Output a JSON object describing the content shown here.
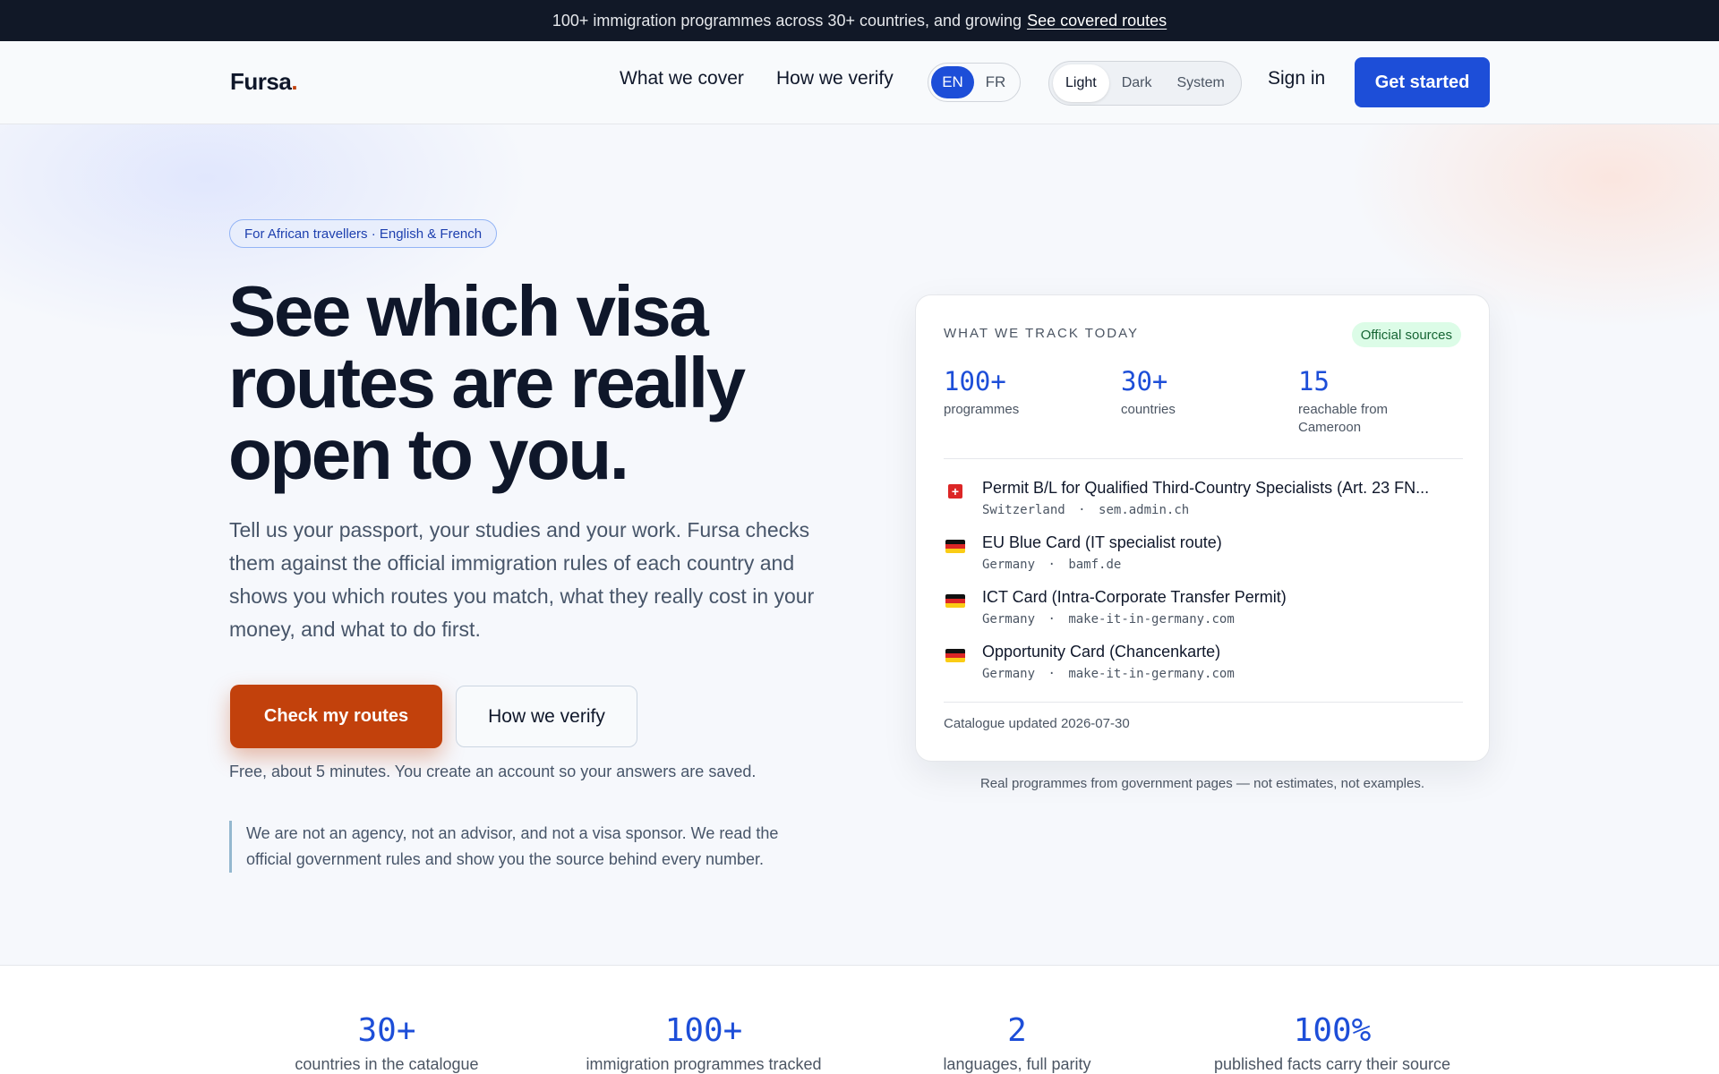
{
  "announcement": {
    "text": "100+ immigration programmes across 30+ countries, and growing",
    "link": "See covered routes"
  },
  "header": {
    "logo": "Fursa",
    "logo_dot": ".",
    "nav": [
      "What we cover",
      "How we verify"
    ],
    "languages": [
      "EN",
      "FR"
    ],
    "active_language": "EN",
    "themes": [
      "Light",
      "Dark",
      "System"
    ],
    "active_theme": "Light",
    "sign_in": "Sign in",
    "get_started": "Get started"
  },
  "hero": {
    "pill": "For African travellers · English & French",
    "title": "See which visa routes are really open to you.",
    "subtitle": "Tell us your passport, your studies and your work. Fursa checks them against the official immigration rules of each country and shows you which routes you match, what they really cost in your money, and what to do first.",
    "primary_cta": "Check my routes",
    "secondary_cta": "How we verify",
    "note": "Free, about 5 minutes. You create an account so your answers are saved.",
    "disclaimer": "We are not an agency, not an advisor, and not a visa sponsor. We read the official government rules and show you the source behind every number."
  },
  "card": {
    "label": "What we track today",
    "badge": "Official sources",
    "stats": [
      {
        "value": "100+",
        "label": "programmes"
      },
      {
        "value": "30+",
        "label": "countries"
      },
      {
        "value": "15",
        "label": "reachable from Cameroon"
      }
    ],
    "routes": [
      {
        "name": "Permit B/L for Qualified Third-Country Specialists (Art. 23 FN...",
        "country": "Switzerland",
        "source": "sem.admin.ch",
        "flag": "switzerland-flag"
      },
      {
        "name": "EU Blue Card (IT specialist route)",
        "country": "Germany",
        "source": "bamf.de",
        "flag": "germany-flag"
      },
      {
        "name": "ICT Card (Intra-Corporate Transfer Permit)",
        "country": "Germany",
        "source": "make-it-in-germany.com",
        "flag": "germany-flag"
      },
      {
        "name": "Opportunity Card (Chancenkarte)",
        "country": "Germany",
        "source": "make-it-in-germany.com",
        "flag": "germany-flag"
      }
    ],
    "meta_separator": "·",
    "footer": "Catalogue updated 2026-07-30",
    "caption": "Real programmes from government pages — not estimates, not examples."
  },
  "stats_strip": [
    {
      "value": "30+",
      "label": "countries in the catalogue"
    },
    {
      "value": "100+",
      "label": "immigration programmes tracked"
    },
    {
      "value": "2",
      "label": "languages, full parity"
    },
    {
      "value": "100%",
      "label": "published facts carry their source"
    }
  ],
  "colors": {
    "brand_blue": "#1d4ed8",
    "brand_orange": "#c2410c",
    "dark": "#111827"
  }
}
